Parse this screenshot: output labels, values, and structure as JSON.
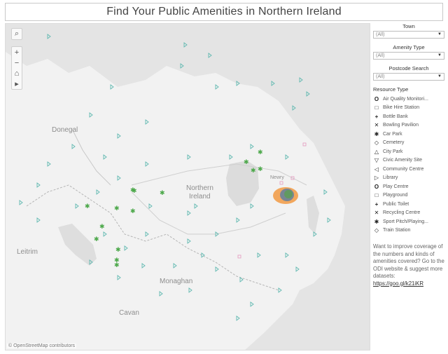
{
  "title": "Find Your Public Amenities in Northern Ireland",
  "map": {
    "labels": {
      "donegal": "Donegal",
      "northern_ireland_1": "Northern",
      "northern_ireland_2": "Ireland",
      "leitrim": "Leitrim",
      "monaghan": "Monaghan",
      "cavan": "Cavan",
      "newry": "Newry"
    },
    "attribution": "© OpenStreetMap contributors",
    "tools": {
      "search": "⌕",
      "zoom_in": "+",
      "zoom_out": "−",
      "home": "⌂",
      "pan": "▸"
    }
  },
  "filters": [
    {
      "label": "Town",
      "value": "(All)"
    },
    {
      "label": "Amenity Type",
      "value": "(All)"
    },
    {
      "label": "Postcode Search",
      "value": "(All)"
    }
  ],
  "legend": {
    "title": "Resource Type",
    "items": [
      {
        "symbol": "O",
        "label": "Air Quality Monitori..."
      },
      {
        "symbol": "□",
        "label": "Bike Hire Station"
      },
      {
        "symbol": "+",
        "label": "Bottle Bank"
      },
      {
        "symbol": "✕",
        "label": "Bowling Pavilion"
      },
      {
        "symbol": "✱",
        "label": "Car Park"
      },
      {
        "symbol": "◇",
        "label": "Cemetery"
      },
      {
        "symbol": "△",
        "label": "City Park"
      },
      {
        "symbol": "▽",
        "label": "Civic Amenity Site"
      },
      {
        "symbol": "◁",
        "label": "Community Centre"
      },
      {
        "symbol": "▷",
        "label": "Library"
      },
      {
        "symbol": "O",
        "label": "Play Centre"
      },
      {
        "symbol": "□",
        "label": "Playground"
      },
      {
        "symbol": "+",
        "label": "Public Toilet"
      },
      {
        "symbol": "✕",
        "label": "Recycling Centre"
      },
      {
        "symbol": "✱",
        "label": "Sport Pitch/Playing..."
      },
      {
        "symbol": "◇",
        "label": "Train Station"
      }
    ]
  },
  "note": {
    "text": "Want to improve coverage of the numbers and kinds of amenities covered? Go to the ODI website & suggest more datasets:",
    "link": "https://goo.gl/k21iKR"
  },
  "colors": {
    "library": "#5fb8b0",
    "sport": "#4ca84a",
    "orange": "#f28e2b",
    "blue": "#4e79a7",
    "pink": "#e6a1c4"
  }
}
